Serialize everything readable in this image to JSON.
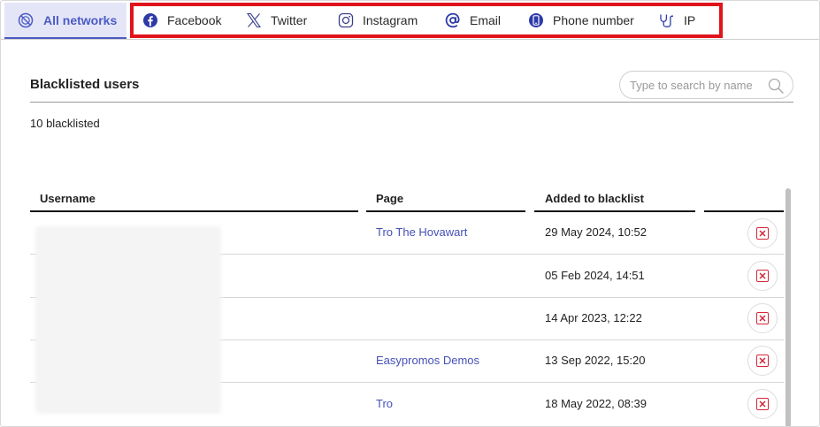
{
  "tabs": {
    "all_networks": "All networks",
    "facebook": "Facebook",
    "twitter": "Twitter",
    "instagram": "Instagram",
    "email": "Email",
    "phone": "Phone number",
    "ip": "IP"
  },
  "header": {
    "title": "Blacklisted users",
    "search_placeholder": "Type to search by name",
    "count": "10 blacklisted"
  },
  "table": {
    "columns": [
      "Username",
      "Page",
      "Added to blacklist",
      ""
    ],
    "rows": [
      {
        "page": "Tro The Hovawart",
        "added": "29 May 2024, 10:52"
      },
      {
        "page": "",
        "added": "05 Feb 2024, 14:51"
      },
      {
        "page": "",
        "added": "14 Apr 2023, 12:22"
      },
      {
        "page": "Easypromos Demos",
        "added": "13 Sep 2022, 15:20"
      },
      {
        "page": "Tro",
        "added": "18 May 2022, 08:39"
      }
    ]
  },
  "colors": {
    "accent": "#4b5bc4",
    "highlight": "#e0141c",
    "delete": "#d2283a",
    "link": "#4450b8"
  },
  "icons": {
    "all_networks": "no-entry-icon",
    "facebook": "facebook-icon",
    "twitter": "x-twitter-icon",
    "instagram": "instagram-icon",
    "email": "at-sign-icon",
    "phone": "phone-icon",
    "ip": "plug-icon",
    "search": "search-icon",
    "delete": "close-box-icon"
  }
}
